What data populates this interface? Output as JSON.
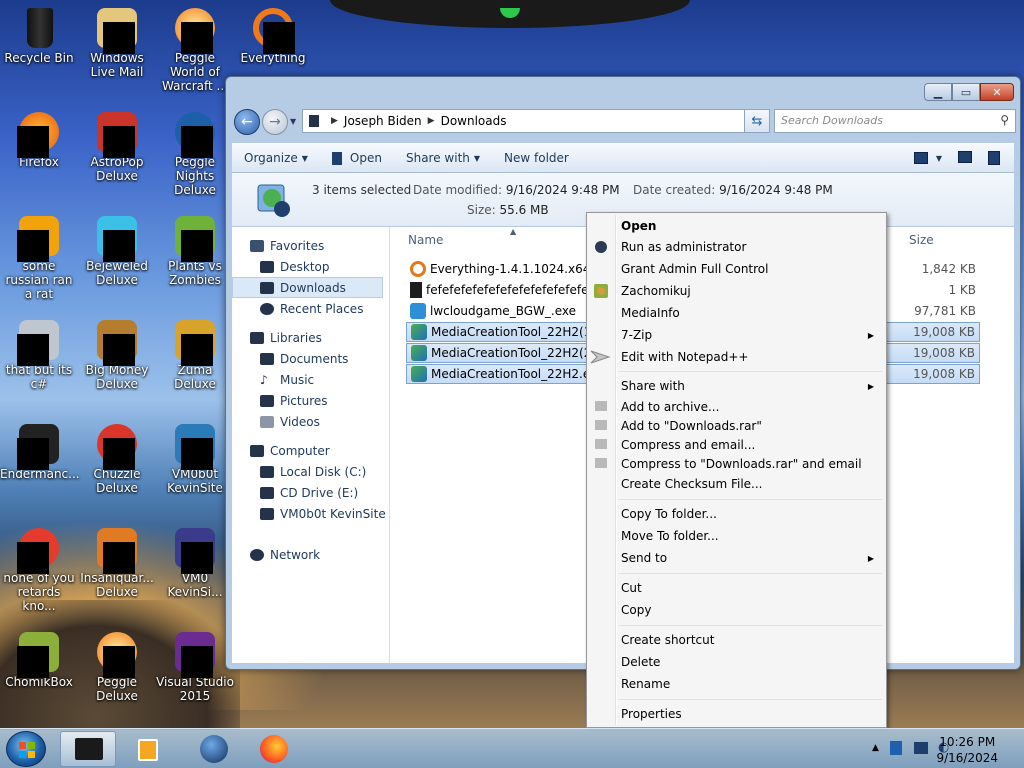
{
  "desktop": {
    "icons": [
      {
        "label": "Recycle Bin"
      },
      {
        "label": "Windows Live Mail"
      },
      {
        "label": "Peggle World of Warcraft ..."
      },
      {
        "label": "Everything"
      },
      {
        "label": "Firefox"
      },
      {
        "label": "AstroPop Deluxe"
      },
      {
        "label": "Peggle Nights Deluxe"
      },
      {
        "label": "some russian ran a rat"
      },
      {
        "label": "Bejeweled Deluxe"
      },
      {
        "label": "Plants vs Zombies"
      },
      {
        "label": "that but its c#"
      },
      {
        "label": "Big Money Deluxe"
      },
      {
        "label": "Zuma Deluxe"
      },
      {
        "label": "Endermanc..."
      },
      {
        "label": "Chuzzle Deluxe"
      },
      {
        "label": "VM0b0t KevinSite"
      },
      {
        "label": "none of you retards kno..."
      },
      {
        "label": "Insaniquar... Deluxe"
      },
      {
        "label": "VM0 KevinSi..."
      },
      {
        "label": "ChomikBox"
      },
      {
        "label": "Peggle Deluxe"
      },
      {
        "label": "Visual Studio 2015"
      }
    ]
  },
  "window": {
    "breadcrumb": [
      "Joseph Biden",
      "Downloads"
    ],
    "search_placeholder": "Search Downloads",
    "toolbar": {
      "organize": "Organize",
      "open": "Open",
      "share_with": "Share with",
      "new_folder": "New folder"
    },
    "details": {
      "selection": "3 items selected",
      "modified_label": "Date modified:",
      "modified_value": "9/16/2024 9:48 PM",
      "created_label": "Date created:",
      "created_value": "9/16/2024 9:48 PM",
      "size_label": "Size:",
      "size_value": "55.6 MB"
    },
    "nav": {
      "favorites": "Favorites",
      "desktop": "Desktop",
      "downloads": "Downloads",
      "recent": "Recent Places",
      "libraries": "Libraries",
      "documents": "Documents",
      "music": "Music",
      "pictures": "Pictures",
      "videos": "Videos",
      "computer": "Computer",
      "local_disk": "Local Disk (C:)",
      "cd_drive": "CD Drive (E:)",
      "vm_drive": "VM0b0t KevinSite",
      "network": "Network"
    },
    "columns": {
      "name": "Name",
      "size": "Size"
    },
    "files": [
      {
        "name": "Everything-1.4.1.1024.x64-Setu",
        "size": "1,842 KB",
        "selected": false,
        "icon": "everything-icon"
      },
      {
        "name": "fefefefefefefefefefefefefefefef",
        "size": "1 KB",
        "selected": false,
        "icon": "file-icon"
      },
      {
        "name": "lwcloudgame_BGW_.exe",
        "size": "97,781 KB",
        "selected": false,
        "icon": "exe-icon"
      },
      {
        "name": "MediaCreationTool_22H2(1).e",
        "size": "19,008 KB",
        "selected": true,
        "icon": "mct-icon"
      },
      {
        "name": "MediaCreationTool_22H2(2).e",
        "size": "19,008 KB",
        "selected": true,
        "icon": "mct-icon"
      },
      {
        "name": "MediaCreationTool_22H2.exe",
        "size": "19,008 KB",
        "selected": true,
        "icon": "mct-icon"
      }
    ]
  },
  "context_menu": {
    "open": "Open",
    "run_admin": "Run as administrator",
    "grant_admin": "Grant Admin Full Control",
    "zachomikuj": "Zachomikuj",
    "mediainfo": "MediaInfo",
    "seven_zip": "7-Zip",
    "notepad": "Edit with Notepad++",
    "share_with": "Share with",
    "add_archive": "Add to archive...",
    "add_downloads": "Add to \"Downloads.rar\"",
    "compress_email": "Compress and email...",
    "compress_downloads_email": "Compress to \"Downloads.rar\" and email",
    "checksum": "Create Checksum File...",
    "copy_to": "Copy To folder...",
    "move_to": "Move To folder...",
    "send_to": "Send to",
    "cut": "Cut",
    "copy": "Copy",
    "create_shortcut": "Create shortcut",
    "delete": "Delete",
    "rename": "Rename",
    "properties": "Properties"
  },
  "taskbar": {
    "time": "10:26 PM",
    "date": "9/16/2024"
  }
}
